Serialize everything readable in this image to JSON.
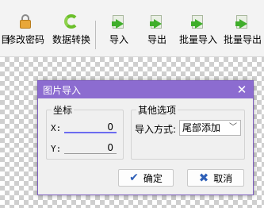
{
  "toolbar": {
    "items": [
      {
        "label": "修改密码",
        "icon": "lock-icon"
      },
      {
        "label": "数据转换",
        "icon": "refresh-icon"
      },
      {
        "label": "导入",
        "icon": "import-arrow-icon"
      },
      {
        "label": "导出",
        "icon": "export-arrow-icon"
      },
      {
        "label": "批量导入",
        "icon": "batch-import-icon"
      },
      {
        "label": "批量导出",
        "icon": "batch-export-icon"
      }
    ],
    "left_edge_label": "目"
  },
  "dialog": {
    "title": "图片导入",
    "close_glyph": "✕",
    "coords": {
      "group_title": "坐标",
      "x_label": "X:",
      "x_value": "0",
      "y_label": "Y:",
      "y_value": "0"
    },
    "options": {
      "group_title": "其他选项",
      "mode_label": "导入方式:",
      "mode_value": "尾部添加"
    },
    "ok_label": "确定",
    "cancel_label": "取消"
  },
  "colors": {
    "titlebar": "#8c6cd0",
    "accent_icon": "#2e5fb7"
  }
}
